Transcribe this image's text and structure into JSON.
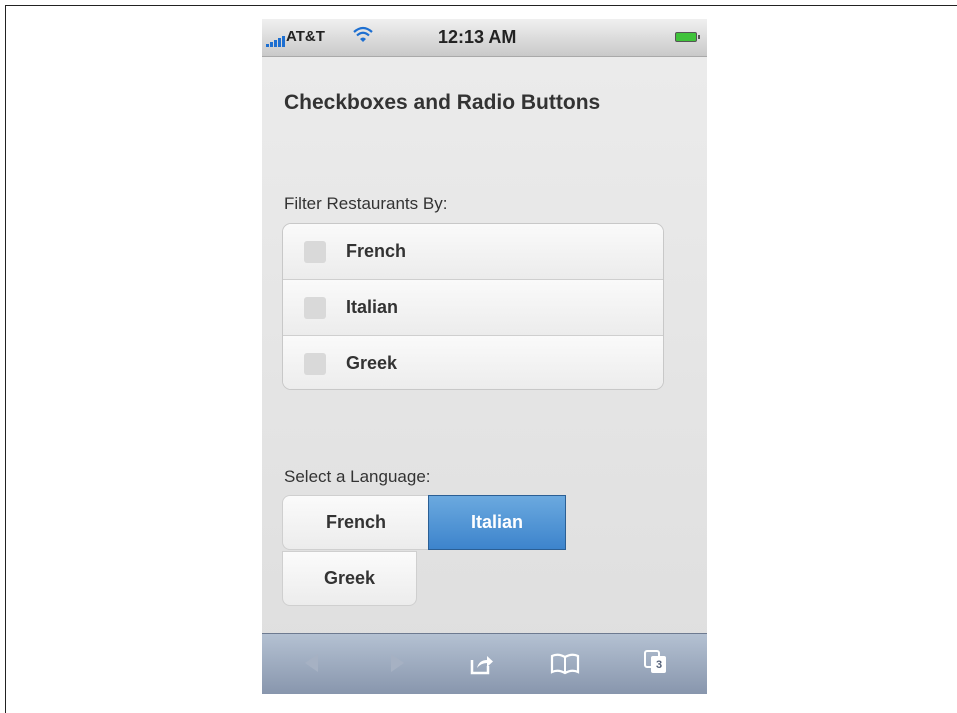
{
  "status_bar": {
    "carrier": "AT&T",
    "time": "12:13 AM"
  },
  "page": {
    "title": "Checkboxes and Radio Buttons"
  },
  "filter": {
    "label": "Filter Restaurants By:",
    "options": [
      "French",
      "Italian",
      "Greek"
    ]
  },
  "language": {
    "label": "Select a Language:",
    "options": [
      "French",
      "Italian",
      "Greek"
    ],
    "selected": "Italian"
  },
  "toolbar": {
    "tabs_count": "3"
  },
  "colors": {
    "selected": "#4a90d2",
    "toolbar": "#9aa6ba"
  }
}
